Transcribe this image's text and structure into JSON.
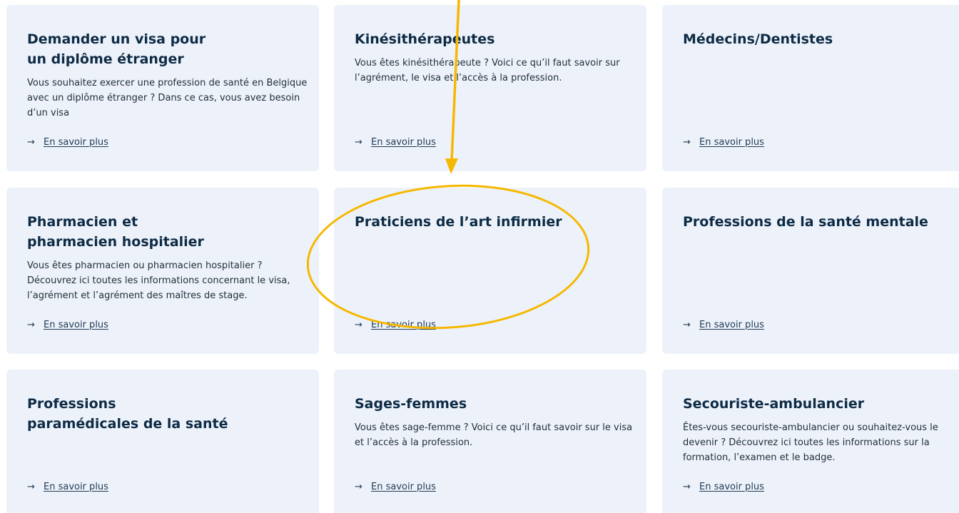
{
  "cards": [
    {
      "title": "Demander un visa pour\nun diplôme étranger",
      "description": "Vous souhaitez exercer une profession de santé en Belgique avec un diplôme étranger ? Dans ce cas, vous avez besoin d’un visa",
      "link": "En savoir plus"
    },
    {
      "title": "Kinésithérapeutes",
      "description": "Vous êtes kinésithérapeute ? Voici ce qu’il faut savoir sur l’agrément, le visa et l’accès à la profession.",
      "link": "En savoir plus"
    },
    {
      "title": "Médecins/Dentistes",
      "description": "",
      "link": "En savoir plus"
    },
    {
      "title": "Pharmacien et\npharmacien hospitalier",
      "description": "Vous êtes pharmacien ou pharmacien hospitalier ? Découvrez ici toutes les informations concernant le visa, l’agrément et l’agrément des maîtres de stage.",
      "link": "En savoir plus"
    },
    {
      "title": "Praticiens de l’art infirmier",
      "description": "",
      "link": "En savoir plus"
    },
    {
      "title": "Professions de la santé mentale",
      "description": "",
      "link": "En savoir plus"
    },
    {
      "title": "Professions\nparamédicales de la santé",
      "description": "",
      "link": "En savoir plus"
    },
    {
      "title": "Sages-femmes",
      "description": "Vous êtes sage-femme ? Voici ce qu’il faut savoir sur le visa et l’accès à la profession.",
      "link": "En savoir plus"
    },
    {
      "title": "Secouriste-ambulancier",
      "description": "Êtes-vous secouriste-ambulancier ou souhaitez-vous le devenir ? Découvrez ici toutes les informations sur la formation, l’examen et le badge.",
      "link": "En savoir plus"
    }
  ],
  "annotation": {
    "color": "#f5b800",
    "target": "Praticiens de l’art infirmier"
  }
}
